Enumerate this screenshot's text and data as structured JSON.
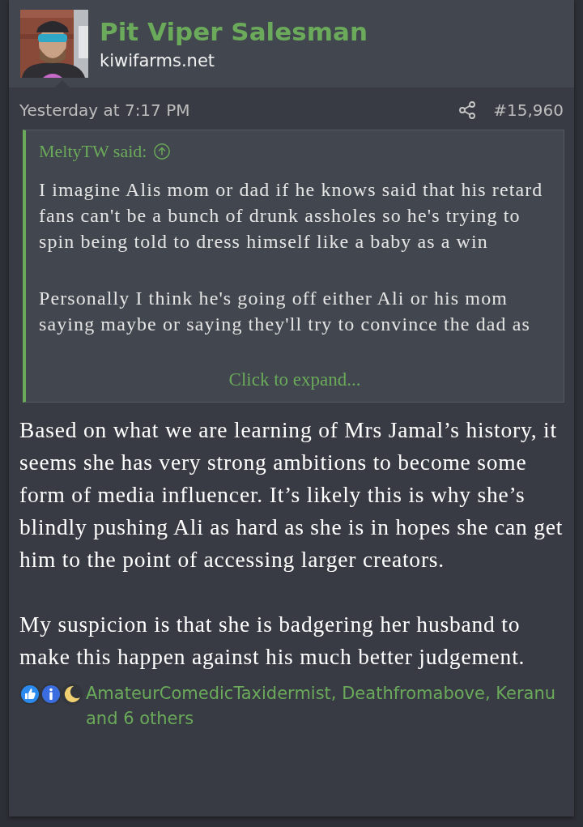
{
  "author": {
    "name": "Pit Viper Salesman",
    "site": "kiwifarms.net"
  },
  "post": {
    "date": "Yesterday at 7:17 PM",
    "number": "#15,960"
  },
  "quote": {
    "author": "MeltyTW said:",
    "paragraphs": [
      "I imagine Alis mom or dad if he knows said that his retard fans can't be a bunch of drunk assholes so he's trying to spin being told to dress himself like a baby as a win",
      "Personally I think he's going off either Ali or his mom saying maybe or saying they'll try to convince the dad as"
    ],
    "expand": "Click to expand...",
    "expanded": false
  },
  "body": [
    "Based on what we are learning of Mrs Jamal’s history, it seems she has very strong ambitions to become some form of media influencer. It’s likely this is why she’s blindly pushing Ali as hard as she is in hopes she can get him to the point of accessing larger creators.",
    "My suspicion is that she is badgering her husband to make this happen against his much better judgement."
  ],
  "reactions": {
    "icons": [
      {
        "kind": "like"
      },
      {
        "kind": "info"
      },
      {
        "kind": "moon"
      }
    ],
    "text": "AmateurComedicTaxidermist, Deathfromabove, Keranu and 6 others"
  }
}
